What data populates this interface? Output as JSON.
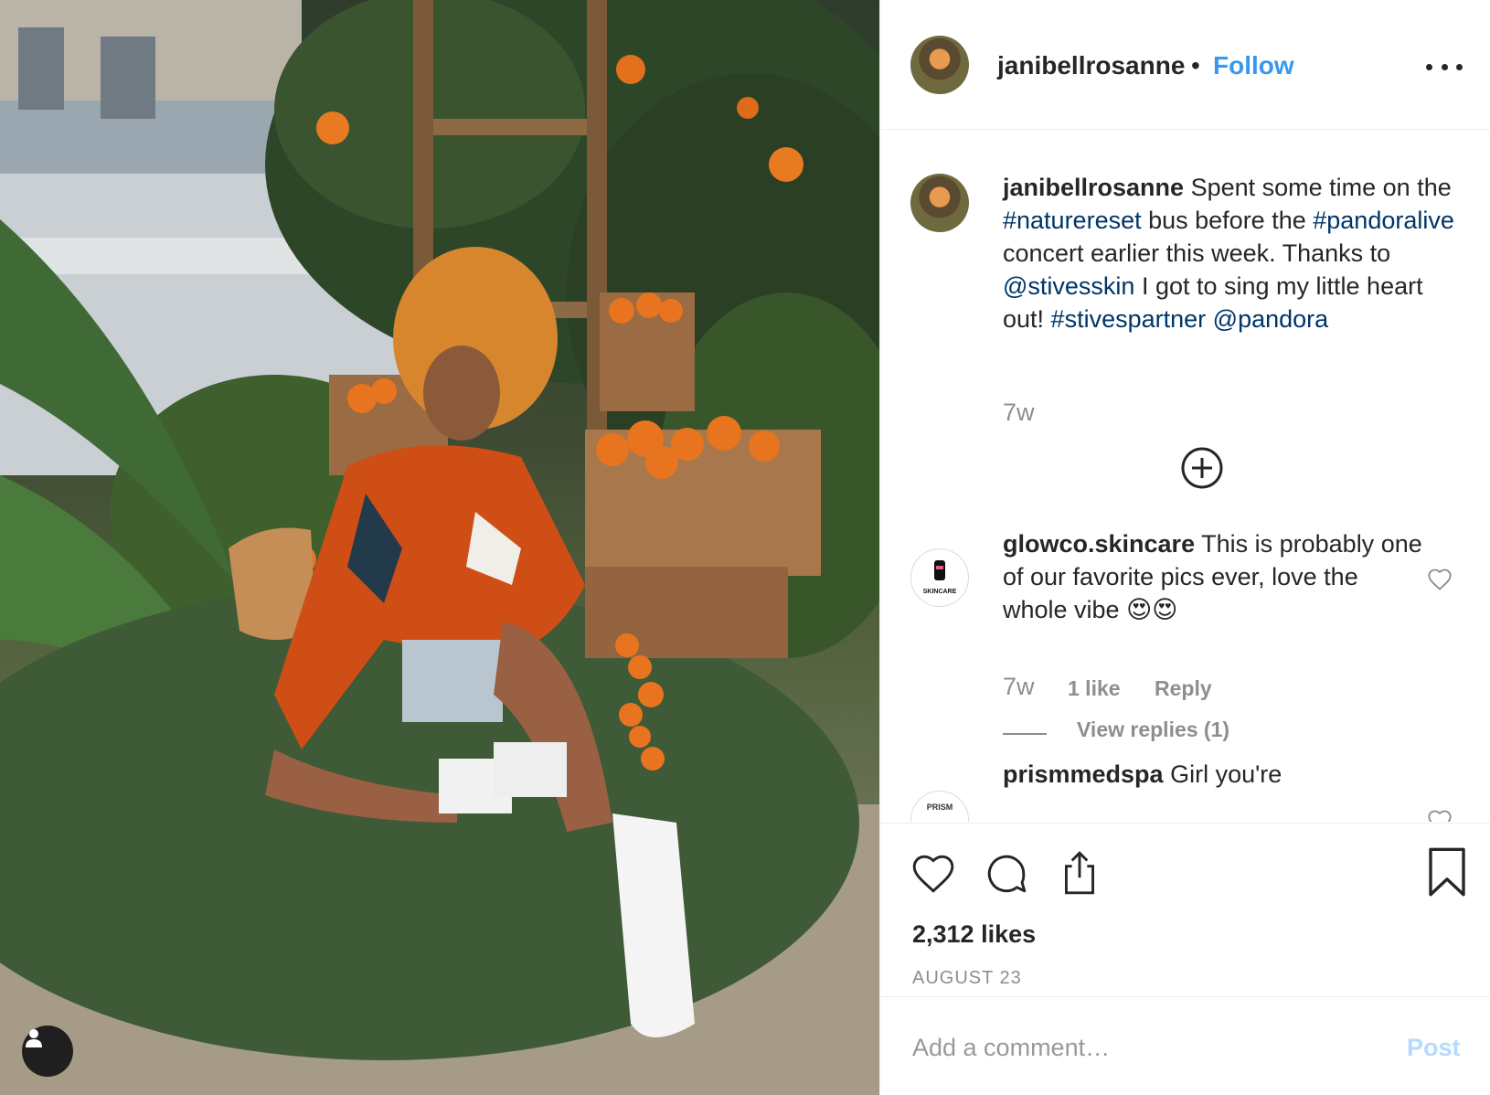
{
  "post": {
    "image_alt": "",
    "tag_icon": "user-icon"
  },
  "header": {
    "username": "janibellrosanne",
    "separator": "•",
    "follow_label": "Follow",
    "more_icon": "more-options-icon"
  },
  "caption": {
    "username": "janibellrosanne",
    "parts": [
      " Spent some time on the ",
      "#naturereset",
      " bus before the ",
      "#pandoralive",
      " concert earlier this week. Thanks to ",
      "@stivesskin",
      " I got to sing my little heart out! ",
      "#stivespartner",
      " ",
      "@pandora"
    ],
    "time": "7w",
    "load_more_icon": "circle-plus-icon"
  },
  "comments": [
    {
      "username": "glowco.skincare",
      "text": " This is probably one of our favorite pics ever, love the whole vibe 😍😍",
      "time": "7w",
      "likes": "1 like",
      "reply_label": "Reply",
      "view_replies": "View replies (1)",
      "avatar_label": "SKINCARE"
    },
    {
      "username": "prismmedspa",
      "text": " Girl you're",
      "avatar_label": "PRISM"
    }
  ],
  "actions": {
    "likes_count": "2,312 likes",
    "date": "AUGUST 23"
  },
  "comment_box": {
    "placeholder": "Add a comment…",
    "post_label": "Post"
  },
  "colors": {
    "link": "#003569",
    "follow": "#3897f0",
    "post_disabled": "#b3dbff",
    "muted": "#8e8e8e",
    "text": "#262626"
  }
}
